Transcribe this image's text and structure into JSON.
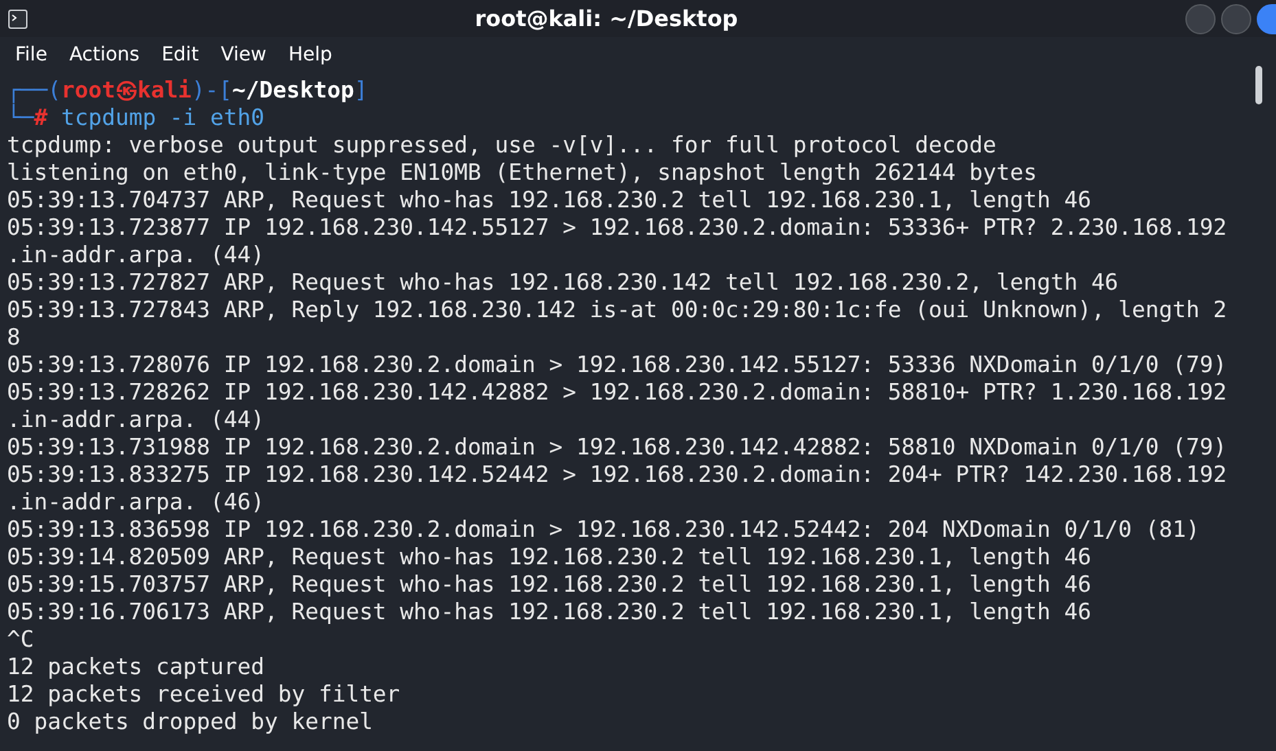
{
  "window": {
    "title": "root@kali: ~/Desktop"
  },
  "menu": [
    "File",
    "Actions",
    "Edit",
    "View",
    "Help"
  ],
  "terminal": {
    "prompt": [
      {
        "kind": "frame",
        "text": "┌──("
      },
      {
        "kind": "user",
        "text": "root㉿kali"
      },
      {
        "kind": "frame",
        "text": ")-["
      },
      {
        "kind": "path",
        "text": "~/Desktop"
      },
      {
        "kind": "frame",
        "text": "]"
      }
    ],
    "command_line": [
      {
        "kind": "frame",
        "text": "└─"
      },
      {
        "kind": "user",
        "text": "#"
      },
      {
        "kind": "command",
        "text": " tcpdump -i eth0"
      }
    ],
    "output": [
      "tcpdump: verbose output suppressed, use -v[v]... for full protocol decode",
      "listening on eth0, link-type EN10MB (Ethernet), snapshot length 262144 bytes",
      "05:39:13.704737 ARP, Request who-has 192.168.230.2 tell 192.168.230.1, length 46",
      "05:39:13.723877 IP 192.168.230.142.55127 > 192.168.230.2.domain: 53336+ PTR? 2.230.168.192",
      ".in-addr.arpa. (44)",
      "05:39:13.727827 ARP, Request who-has 192.168.230.142 tell 192.168.230.2, length 46",
      "05:39:13.727843 ARP, Reply 192.168.230.142 is-at 00:0c:29:80:1c:fe (oui Unknown), length 2",
      "8",
      "05:39:13.728076 IP 192.168.230.2.domain > 192.168.230.142.55127: 53336 NXDomain 0/1/0 (79)",
      "05:39:13.728262 IP 192.168.230.142.42882 > 192.168.230.2.domain: 58810+ PTR? 1.230.168.192",
      ".in-addr.arpa. (44)",
      "05:39:13.731988 IP 192.168.230.2.domain > 192.168.230.142.42882: 58810 NXDomain 0/1/0 (79)",
      "05:39:13.833275 IP 192.168.230.142.52442 > 192.168.230.2.domain: 204+ PTR? 142.230.168.192",
      ".in-addr.arpa. (46)",
      "05:39:13.836598 IP 192.168.230.2.domain > 192.168.230.142.52442: 204 NXDomain 0/1/0 (81)",
      "05:39:14.820509 ARP, Request who-has 192.168.230.2 tell 192.168.230.1, length 46",
      "05:39:15.703757 ARP, Request who-has 192.168.230.2 tell 192.168.230.1, length 46",
      "05:39:16.706173 ARP, Request who-has 192.168.230.2 tell 192.168.230.1, length 46",
      "^C",
      "12 packets captured",
      "12 packets received by filter",
      "0 packets dropped by kernel"
    ]
  }
}
